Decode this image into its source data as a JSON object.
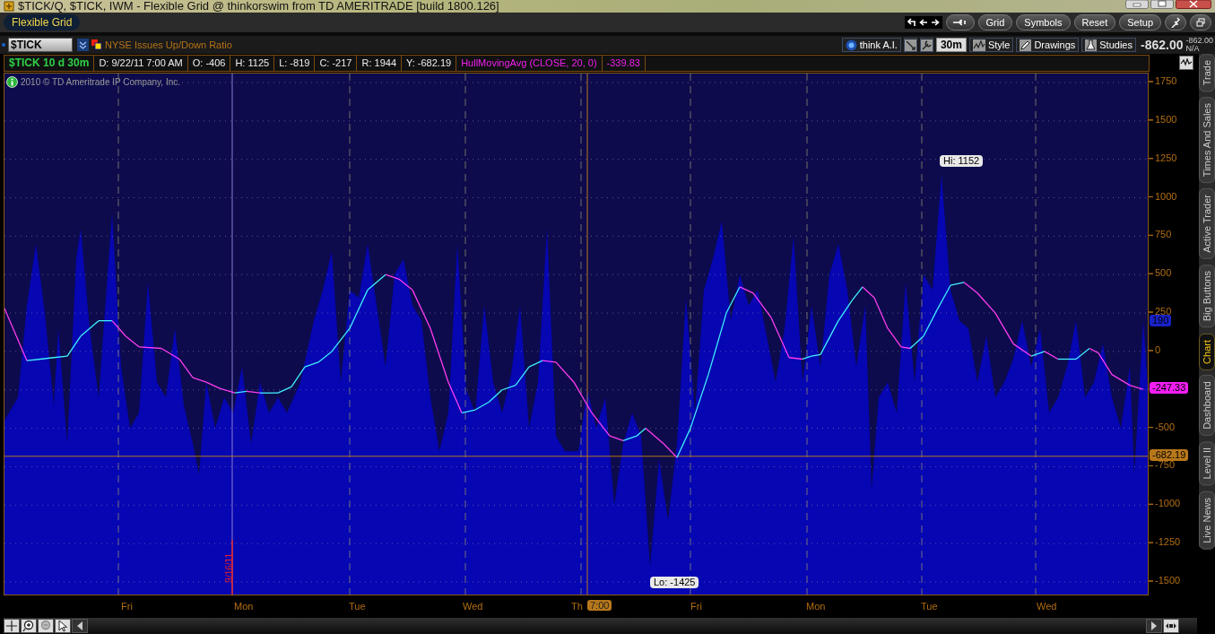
{
  "window": {
    "title": "$TICK/Q, $TICK, IWM - Flexible Grid @ thinkorswim from TD AMERITRADE [build 1800.126]"
  },
  "toolbar": {
    "layout_name": "Flexible Grid",
    "buttons": [
      "Grid",
      "Symbols",
      "Reset",
      "Setup"
    ]
  },
  "symbol_bar": {
    "symbol": "$TICK",
    "description": "NYSE Issues Up/Down Ratio",
    "tools": [
      {
        "kind": "icon-text",
        "label": "think A.I."
      },
      {
        "kind": "icon"
      },
      {
        "kind": "icon"
      },
      {
        "kind": "text",
        "label": "30m"
      },
      {
        "kind": "icon-text",
        "label": "Style"
      },
      {
        "kind": "icon-text",
        "label": "Drawings"
      },
      {
        "kind": "icon-text",
        "label": "Studies"
      }
    ],
    "last_price": "-862.00",
    "net_change": "-862.00",
    "percent_change": "N/A"
  },
  "chart_header": {
    "title": "$TICK 10 d 30m",
    "fields": [
      "D: 9/22/11 7:00 AM",
      "O: -406",
      "H: 1125",
      "L: -819",
      "C: -217",
      "R: 1944",
      "Y: -682.19"
    ],
    "study": "HullMovingAvg (CLOSE, 20, 0)",
    "study_value": "-339.83"
  },
  "chart": {
    "copyright": "2010 © TD Ameritrade IP Company, Inc.",
    "y_axis_labels": [
      "1750",
      "1500",
      "1250",
      "1000",
      "750",
      "500",
      "250",
      "0",
      "-500",
      "-750",
      "-1000",
      "-1250",
      "-1500"
    ],
    "price_tags": [
      {
        "kind": "last",
        "text": "190"
      },
      {
        "kind": "study",
        "text": "-247.33"
      },
      {
        "kind": "cursor",
        "text": "-682.19"
      }
    ],
    "high_label": "Hi: 1152",
    "low_label": "Lo: -1425",
    "date_marker": "9/16/11",
    "x_axis_labels": [
      "Fri",
      "Mon",
      "Tue",
      "Wed",
      "Th",
      "Fri",
      "Mon",
      "Tue",
      "Wed"
    ],
    "cursor_time": "7:00"
  },
  "side_tabs": [
    {
      "label": "Trade",
      "selected": false
    },
    {
      "label": "Times And Sales",
      "selected": false
    },
    {
      "label": "Active Trader",
      "selected": false
    },
    {
      "label": "Big Buttons",
      "selected": false
    },
    {
      "label": "Chart",
      "selected": true
    },
    {
      "label": "Dashboard",
      "selected": false
    },
    {
      "label": "Level II",
      "selected": false
    },
    {
      "label": "Live News",
      "selected": false
    }
  ]
}
